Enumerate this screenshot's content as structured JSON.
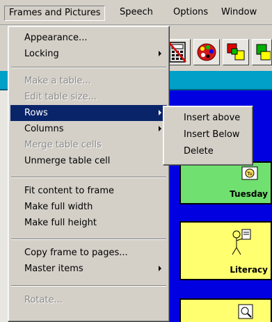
{
  "menubar": {
    "items": [
      "Frames and Pictures",
      "Speech",
      "Options",
      "Window"
    ]
  },
  "menu": {
    "items": [
      {
        "label": "Appearance...",
        "enabled": true
      },
      {
        "label": "Locking",
        "enabled": true,
        "submenu": true
      },
      {
        "label": "Make a table...",
        "enabled": false
      },
      {
        "label": "Edit table size...",
        "enabled": false
      },
      {
        "label": "Rows",
        "enabled": true,
        "submenu": true,
        "highlighted": true
      },
      {
        "label": "Columns",
        "enabled": true,
        "submenu": true
      },
      {
        "label": "Merge table cells",
        "enabled": false
      },
      {
        "label": "Unmerge table cell",
        "enabled": true
      },
      {
        "label": "Fit content to frame",
        "enabled": true
      },
      {
        "label": "Make full width",
        "enabled": true
      },
      {
        "label": "Make full height",
        "enabled": true
      },
      {
        "label": "Copy frame to pages...",
        "enabled": true
      },
      {
        "label": "Master items",
        "enabled": true,
        "submenu": true
      },
      {
        "label": "Rotate...",
        "enabled": false
      }
    ]
  },
  "rows_submenu": {
    "items": [
      "Insert above",
      "Insert Below",
      "Delete"
    ]
  },
  "cells": [
    {
      "label": "Tuesday",
      "color": "#70e070"
    },
    {
      "label": "Literacy",
      "color": "#ffff70"
    },
    {
      "label": "",
      "color": "#ffff70"
    }
  ],
  "icons": {
    "toolbar": [
      "calculator-icon",
      "no-symbol-icon",
      "palette-icon",
      "shapes-icon"
    ]
  }
}
